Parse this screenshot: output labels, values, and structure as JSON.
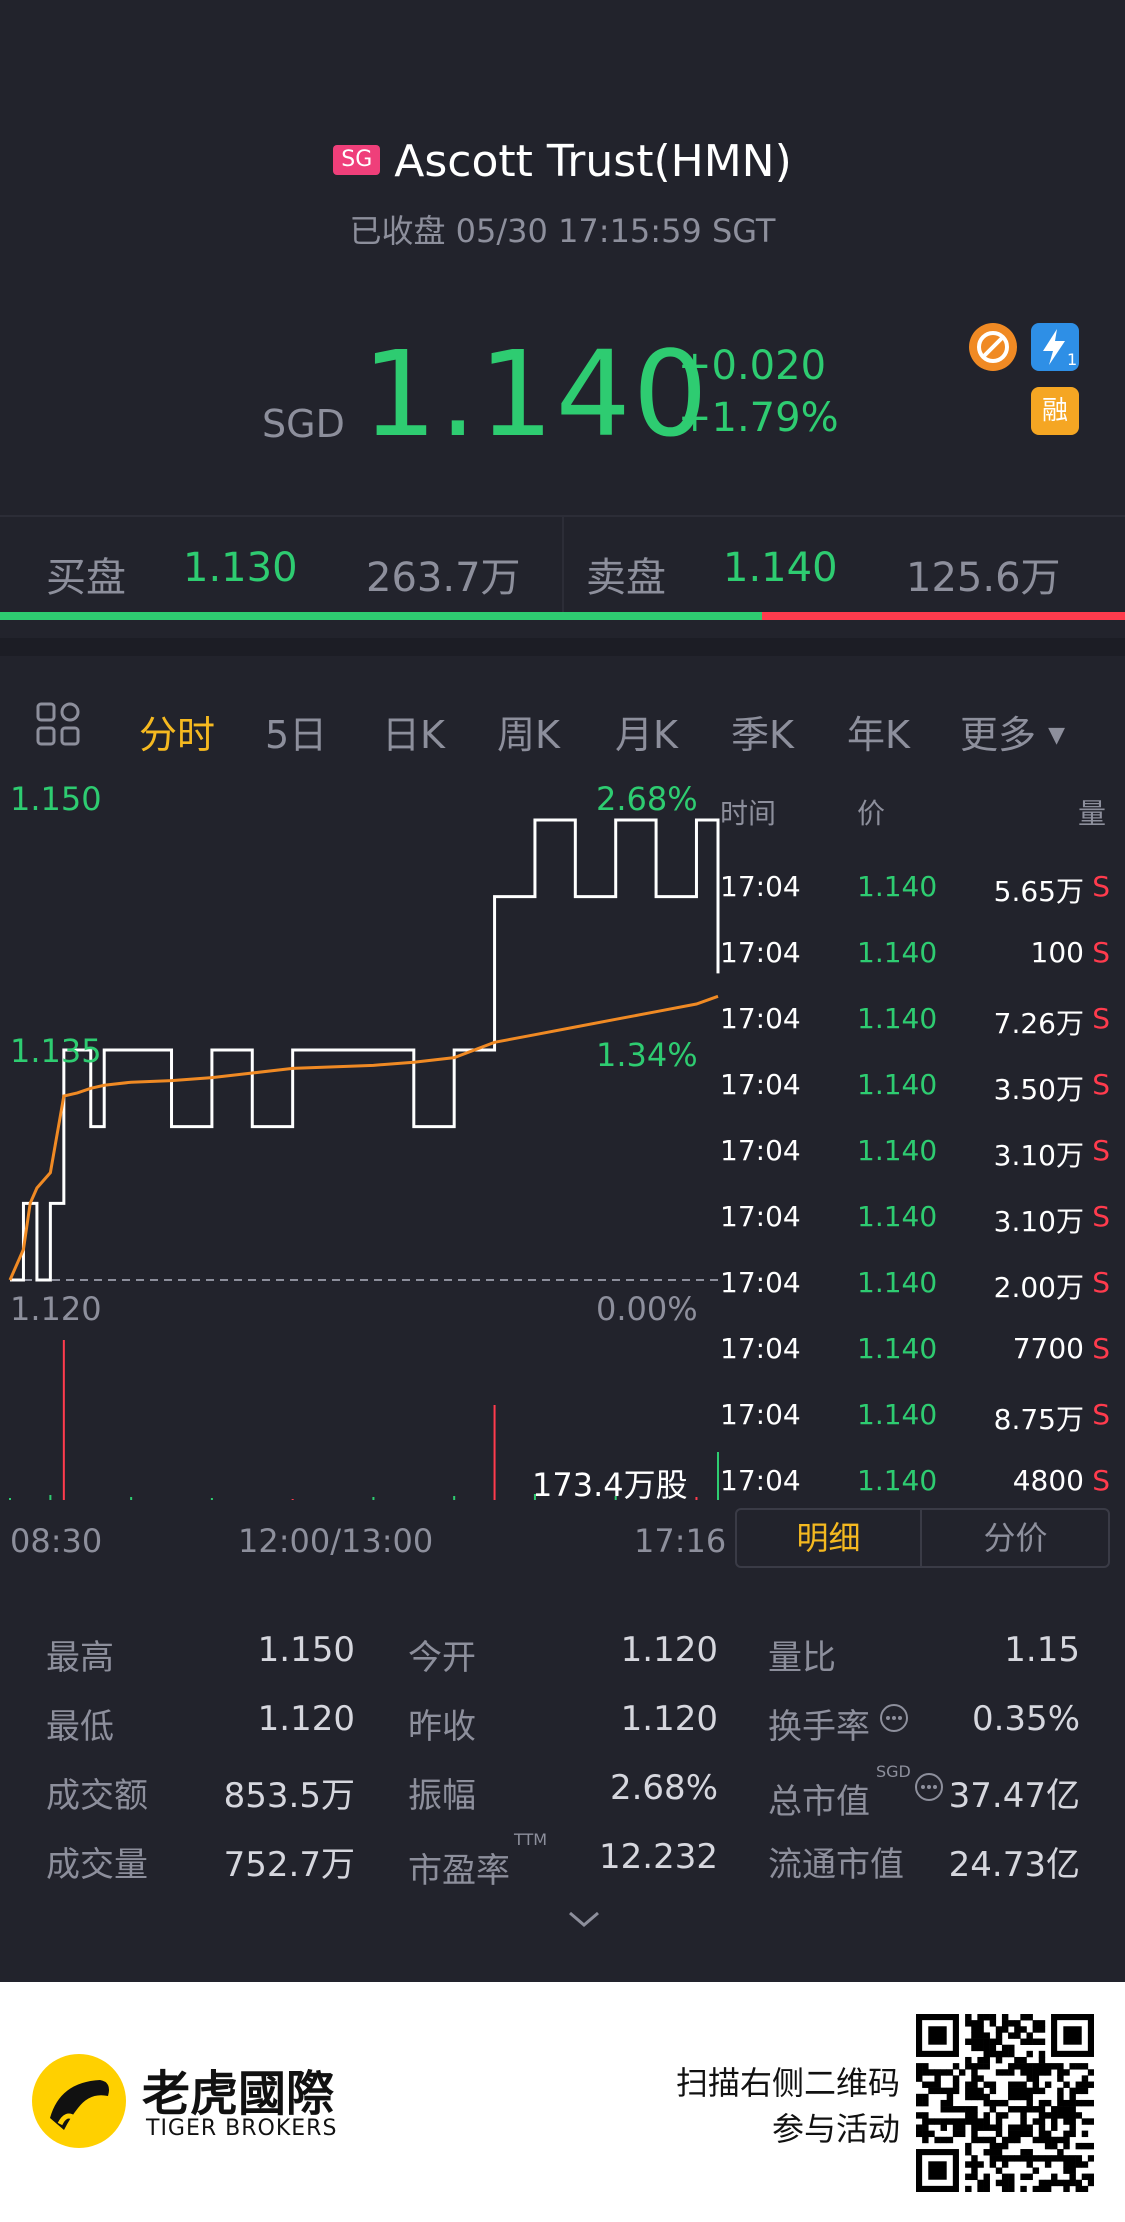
{
  "header": {
    "market_badge": "SG",
    "title": "Ascott Trust(HMN)",
    "status": "已收盘 05/30 17:15:59 SGT",
    "currency": "SGD",
    "price": "1.140",
    "change": "+0.020",
    "change_pct": "+1.79%",
    "icons": [
      "no-shorting-icon",
      "level1-lightning-icon",
      "margin-icon"
    ],
    "margin_label": "融"
  },
  "bidask": {
    "bid_label": "买盘",
    "bid_price": "1.130",
    "bid_volume": "263.7万",
    "ask_label": "卖盘",
    "ask_price": "1.140",
    "ask_volume": "125.6万",
    "bid_ratio": 0.677,
    "colors": {
      "bid": "#2ecc71",
      "ask": "#ff3b4d"
    }
  },
  "tabs": [
    "分时",
    "5日",
    "日K",
    "周K",
    "月K",
    "季K",
    "年K",
    "更多"
  ],
  "active_tab": "分时",
  "chart": {
    "y_high": "1.150",
    "y_mid": "1.135",
    "y_low": "1.120",
    "pct_high": "2.68%",
    "pct_mid": "1.34%",
    "pct_low": "0.00%",
    "volume_label": "173.4万股",
    "time_start": "08:30",
    "time_mid": "12:00/13:00",
    "time_end": "17:16"
  },
  "chart_data": {
    "type": "line",
    "title": "",
    "xlabel": "",
    "ylabel": "",
    "ylim": [
      1.12,
      1.15
    ],
    "series": [
      {
        "x": [
          "08:30",
          "08:40",
          "08:45",
          "08:50",
          "09:00",
          "09:10",
          "09:20",
          "09:30",
          "09:40",
          "10:00",
          "10:30",
          "11:00",
          "11:30",
          "12:00",
          "13:00",
          "13:30",
          "14:00",
          "14:30",
          "15:00",
          "15:30",
          "16:00",
          "16:30",
          "17:00",
          "17:16"
        ],
        "values": [
          1.12,
          1.125,
          1.125,
          1.12,
          1.125,
          1.135,
          1.135,
          1.13,
          1.135,
          1.135,
          1.13,
          1.135,
          1.13,
          1.135,
          1.135,
          1.13,
          1.135,
          1.145,
          1.15,
          1.145,
          1.15,
          1.145,
          1.15,
          1.14
        ]
      },
      {
        "x": [
          "08:30",
          "08:40",
          "08:45",
          "08:50",
          "09:00",
          "09:10",
          "09:20",
          "09:30",
          "09:40",
          "10:00",
          "10:30",
          "11:00",
          "11:30",
          "12:00",
          "13:00",
          "13:30",
          "14:00",
          "14:30",
          "15:00",
          "15:30",
          "16:00",
          "16:30",
          "17:00",
          "17:16"
        ],
        "values": [
          1.12,
          1.122,
          1.125,
          1.126,
          1.127,
          1.132,
          1.1322,
          1.1325,
          1.1327,
          1.1329,
          1.133,
          1.1332,
          1.1335,
          1.1338,
          1.134,
          1.1342,
          1.1345,
          1.1355,
          1.136,
          1.1365,
          1.137,
          1.1375,
          1.138,
          1.1385
        ]
      }
    ],
    "volume": {
      "x": [
        "08:30",
        "09:00",
        "09:10",
        "10:00",
        "11:00",
        "12:00",
        "13:00",
        "14:00",
        "14:30",
        "15:00",
        "16:00",
        "17:00",
        "17:16"
      ],
      "values": [
        2,
        5,
        160,
        3,
        2,
        1,
        3,
        4,
        95,
        6,
        4,
        3,
        48
      ]
    },
    "grid": false
  },
  "trades": {
    "headers": {
      "time": "时间",
      "price": "价",
      "volume": "量"
    },
    "side_marker": "S",
    "rows": [
      {
        "time": "17:04",
        "price": "1.140",
        "volume": "5.65万"
      },
      {
        "time": "17:04",
        "price": "1.140",
        "volume": "100"
      },
      {
        "time": "17:04",
        "price": "1.140",
        "volume": "7.26万"
      },
      {
        "time": "17:04",
        "price": "1.140",
        "volume": "3.50万"
      },
      {
        "time": "17:04",
        "price": "1.140",
        "volume": "3.10万"
      },
      {
        "time": "17:04",
        "price": "1.140",
        "volume": "3.10万"
      },
      {
        "time": "17:04",
        "price": "1.140",
        "volume": "2.00万"
      },
      {
        "time": "17:04",
        "price": "1.140",
        "volume": "7700"
      },
      {
        "time": "17:04",
        "price": "1.140",
        "volume": "8.75万"
      },
      {
        "time": "17:04",
        "price": "1.140",
        "volume": "4800"
      }
    ],
    "seg_detail": "明细",
    "seg_price": "分价"
  },
  "stats": {
    "high_label": "最高",
    "high": "1.150",
    "open_label": "今开",
    "open": "1.120",
    "vol_ratio_label": "量比",
    "vol_ratio": "1.15",
    "low_label": "最低",
    "low": "1.120",
    "prev_close_label": "昨收",
    "prev_close": "1.120",
    "turnover_rate_label": "换手率",
    "turnover_rate": "0.35%",
    "amount_label": "成交额",
    "amount": "853.5万",
    "amplitude_label": "振幅",
    "amplitude": "2.68%",
    "mkt_cap_label": "总市值",
    "mkt_cap_sup": "SGD",
    "mkt_cap": "37.47亿",
    "volume_label": "成交量",
    "volume": "752.7万",
    "pe_label": "市盈率",
    "pe_sup": "TTM",
    "pe": "12.232",
    "float_cap_label": "流通市值",
    "float_cap": "24.73亿"
  },
  "footer": {
    "brand_cn": "老虎國際",
    "brand_en": "TIGER BROKERS",
    "cta_line1": "扫描右侧二维码",
    "cta_line2": "参与活动"
  }
}
